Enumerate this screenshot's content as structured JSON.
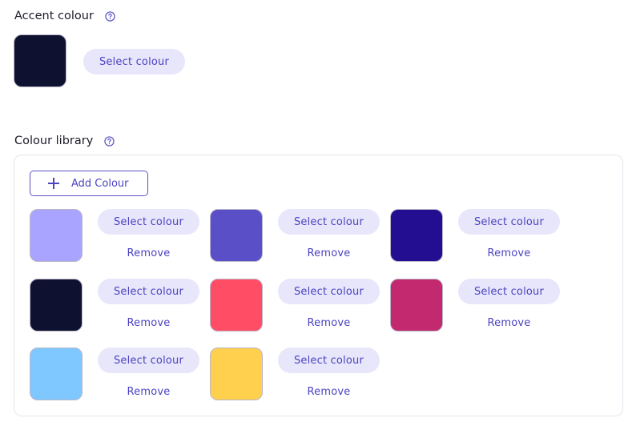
{
  "accent": {
    "title": "Accent colour",
    "colour": "#0e1130",
    "select_label": "Select colour"
  },
  "library": {
    "title": "Colour library",
    "add_label": "Add Colour",
    "items": [
      {
        "colour": "#a8a4ff",
        "select_label": "Select colour",
        "remove_label": "Remove"
      },
      {
        "colour": "#5a4fc6",
        "select_label": "Select colour",
        "remove_label": "Remove"
      },
      {
        "colour": "#230e91",
        "select_label": "Select colour",
        "remove_label": "Remove"
      },
      {
        "colour": "#0e1130",
        "select_label": "Select colour",
        "remove_label": "Remove"
      },
      {
        "colour": "#ff4d66",
        "select_label": "Select colour",
        "remove_label": "Remove"
      },
      {
        "colour": "#c2296e",
        "select_label": "Select colour",
        "remove_label": "Remove"
      },
      {
        "colour": "#7ec8ff",
        "select_label": "Select colour",
        "remove_label": "Remove"
      },
      {
        "colour": "#ffd04d",
        "select_label": "Select colour",
        "remove_label": "Remove"
      }
    ]
  },
  "icons": {
    "help": "help-circle-icon",
    "add": "plus-icon"
  }
}
